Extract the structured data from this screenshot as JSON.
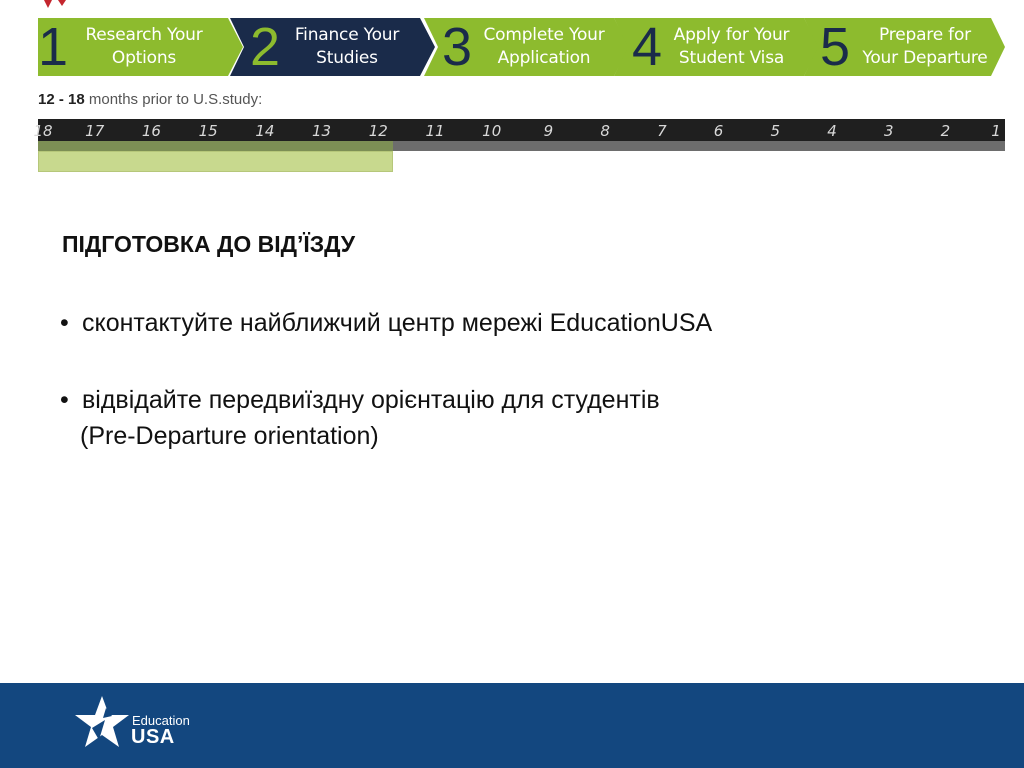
{
  "steps": [
    {
      "number": "1",
      "line1": "Research Your",
      "line2": "Options"
    },
    {
      "number": "2",
      "line1": "Finance Your",
      "line2": "Studies"
    },
    {
      "number": "3",
      "line1": "Complete Your",
      "line2": "Application"
    },
    {
      "number": "4",
      "line1": "Apply for Your",
      "line2": "Student Visa"
    },
    {
      "number": "5",
      "line1": "Prepare for",
      "line2": "Your Departure"
    }
  ],
  "colors": {
    "step_green": "#8dbb2e",
    "step_navy": "#1a2b4a",
    "timeline_highlight": "#c8d98e",
    "footer_blue": "#13477f"
  },
  "months_subtitle": {
    "bold": "12 - 18",
    "normal": " months prior to U.S.study:"
  },
  "timeline": {
    "ticks": [
      "18",
      "17",
      "16",
      "15",
      "14",
      "13",
      "12",
      "11",
      "10",
      "9",
      "8",
      "7",
      "6",
      "5",
      "4",
      "3",
      "2",
      "1"
    ],
    "highlight_from": 18,
    "highlight_to": 12
  },
  "content": {
    "heading": "ПІДГОТОВКА ДО ВІД’ЇЗДУ",
    "bullet_char": "•",
    "bullet1": "сконтактуйте найближчий центр мережі EducationUSA",
    "bullet2_line1": "відвідайте передвиїздну орієнтацію для студентів",
    "bullet2_line2": "(Pre-Departure orientation)"
  },
  "footer": {
    "logo_education": "Education",
    "logo_usa": "USA",
    "logo_icon": "star-icon"
  }
}
